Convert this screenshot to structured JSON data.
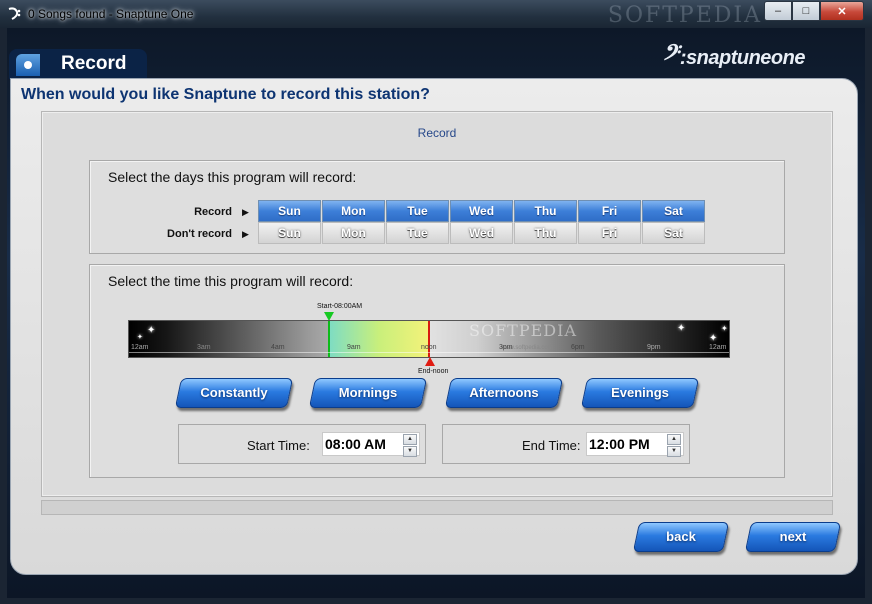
{
  "window": {
    "title": "0 Songs found - Snaptune One",
    "watermark": "SOFTPEDIA",
    "minimize": "–",
    "maximize": "□",
    "close": "✕"
  },
  "brand": {
    "logo_text": ":snaptuneone"
  },
  "tab": {
    "label": "Record"
  },
  "question": "When would you like Snaptune to record this station?",
  "panel_title": "Record",
  "days_section": {
    "label": "Select the days this program will record:",
    "record_label": "Record",
    "dont_record_label": "Don't record",
    "days": [
      "Sun",
      "Mon",
      "Tue",
      "Wed",
      "Thu",
      "Fri",
      "Sat"
    ]
  },
  "time_section": {
    "label": "Select the time this program will record:",
    "start_marker": "Start-08:00AM",
    "end_marker": "End-noon",
    "tick_labels": [
      "12am",
      "3am",
      "4am",
      "9am",
      "noon",
      "3pm",
      "6pm",
      "9pm",
      "12am"
    ],
    "timeline_watermark": "SOFTPEDIA",
    "timeline_watermark_url": "www.softpedia.com",
    "presets": [
      "Constantly",
      "Mornings",
      "Afternoons",
      "Evenings"
    ],
    "start_time_label": "Start Time:",
    "start_time_value": "08:00 AM",
    "end_time_label": "End Time:",
    "end_time_value": "12:00 PM"
  },
  "nav": {
    "back": "back",
    "next": "next"
  }
}
